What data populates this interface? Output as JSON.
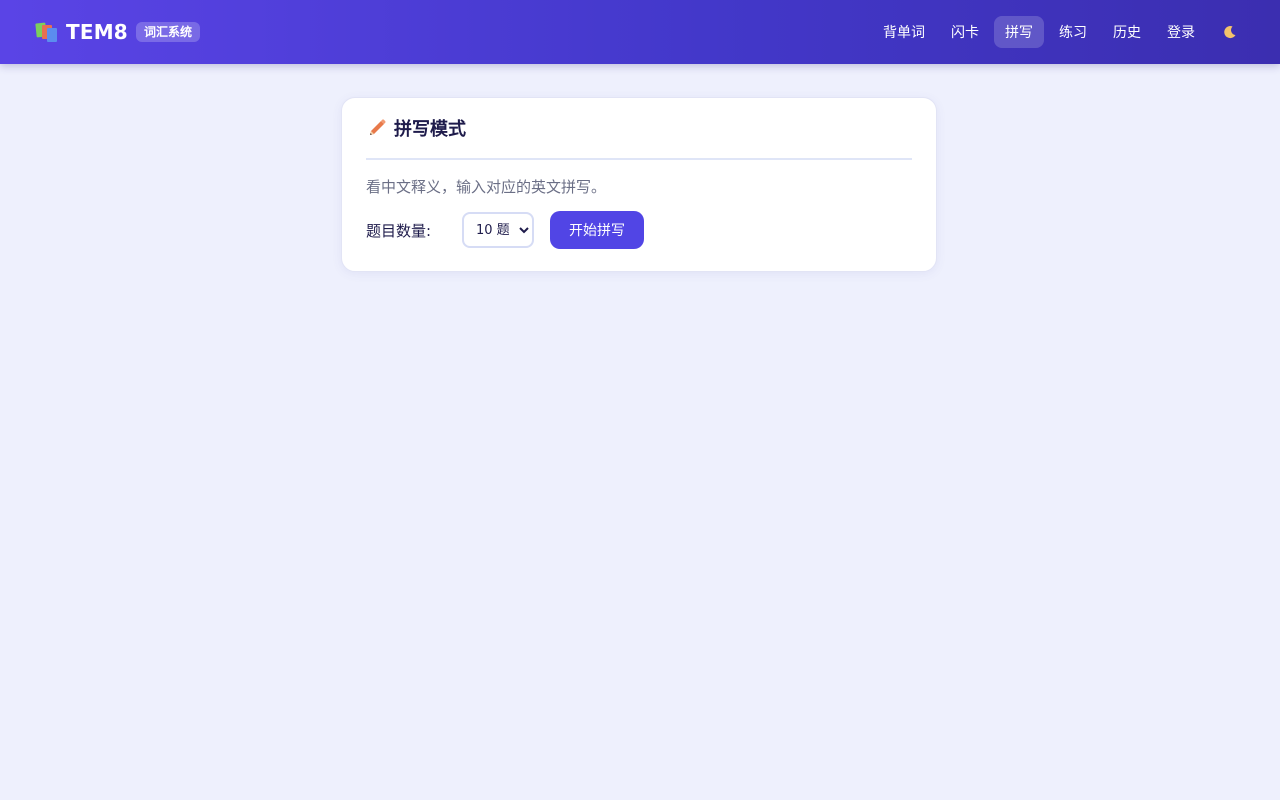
{
  "header": {
    "brand_name": "TEM8",
    "brand_badge": "词汇系统",
    "brand_icon": "books-icon",
    "nav": [
      {
        "label": "背单词",
        "active": false
      },
      {
        "label": "闪卡",
        "active": false
      },
      {
        "label": "拼写",
        "active": true
      },
      {
        "label": "练习",
        "active": false
      },
      {
        "label": "历史",
        "active": false
      },
      {
        "label": "登录",
        "active": false
      }
    ],
    "theme_toggle_icon": "moon-icon"
  },
  "main": {
    "card": {
      "title_icon": "pencil-icon",
      "title": "拼写模式",
      "description": "看中文释义，输入对应的英文拼写。",
      "count_label": "题目数量:",
      "count_select": {
        "selected": "10 题"
      },
      "start_button": "开始拼写"
    }
  },
  "colors": {
    "header_gradient_start": "#5a44e6",
    "header_gradient_end": "#3b2eb0",
    "page_background": "#eef0fd",
    "accent": "#5145e5",
    "pencil": "#e8794a"
  }
}
